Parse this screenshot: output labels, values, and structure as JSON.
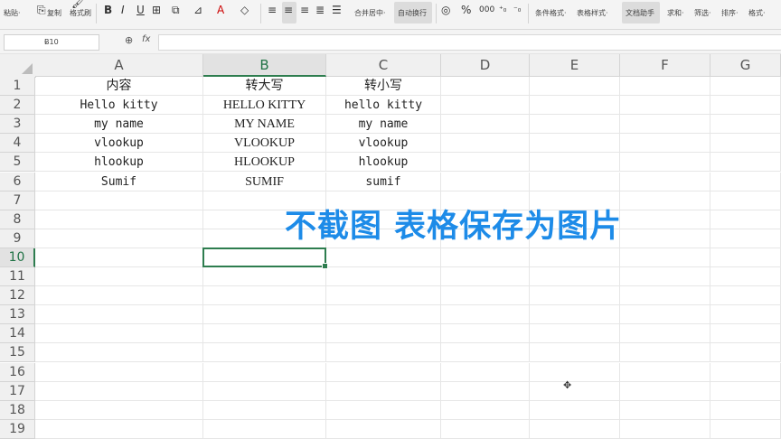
{
  "toolbar": {
    "paste_label": "粘贴·",
    "copy_label": "复制",
    "format_painter_label": "格式刷",
    "bold_label": "B",
    "italic_label": "I",
    "underline_label": "U",
    "merge_center_label": "合并居中·",
    "wrap_text_label": "自动换行",
    "percent_label": "%",
    "cond_format_label": "条件格式·",
    "table_style_label": "表格样式·",
    "doc_assistant_label": "文档助手",
    "sum_label": "求和·",
    "filter_label": "筛选·",
    "sort_label": "排序·",
    "format_label": "格式·"
  },
  "formula_bar": {
    "name_box": "B10",
    "formula": ""
  },
  "columns": [
    "A",
    "B",
    "C",
    "D",
    "E",
    "F",
    "G"
  ],
  "rows": [
    "1",
    "2",
    "3",
    "4",
    "5",
    "6",
    "7",
    "8",
    "9",
    "10",
    "11",
    "12",
    "13",
    "14",
    "15",
    "16",
    "17",
    "18",
    "19"
  ],
  "selected_cell": "B10",
  "cells": {
    "A": [
      "内容",
      "Hello kitty",
      "my name",
      "vlookup",
      "hlookup",
      "Sumif"
    ],
    "B": [
      "转大写",
      "HELLO KITTY",
      "MY NAME",
      "VLOOKUP",
      "HLOOKUP",
      "SUMIF"
    ],
    "C": [
      "转小写",
      "hello kitty",
      "my name",
      "vlookup",
      "hlookup",
      "sumif"
    ]
  },
  "overlay_text": "不截图 表格保存为图片",
  "colors": {
    "accent_green": "#2e7d4f",
    "overlay_blue": "#1d8be8"
  }
}
